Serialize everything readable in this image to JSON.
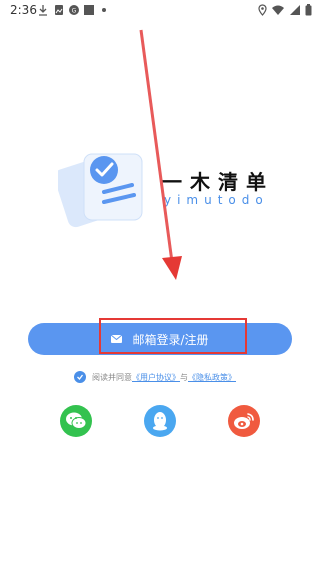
{
  "status_bar": {
    "time": "2:36",
    "left_icons": [
      "download-icon",
      "image-icon",
      "circle-icon",
      "square-icon",
      "dot-icon"
    ],
    "right_icons": [
      "location-icon",
      "wifi-icon",
      "signal-icon",
      "battery-icon"
    ]
  },
  "brand": {
    "title": "一木清单",
    "subtitle": "yimutodo",
    "accent_color": "#4a8fe8"
  },
  "login": {
    "email_button_label": "邮箱登录/注册",
    "button_color": "#5a96f0"
  },
  "agreement": {
    "prefix": "阅读并同意",
    "user_agreement": "《用户协议》",
    "joiner": "与",
    "privacy_policy": "《隐私政策》",
    "checked": true
  },
  "social_login": [
    {
      "name": "wechat-icon",
      "color": "#33c24f"
    },
    {
      "name": "qq-icon",
      "color": "#4aa7f0"
    },
    {
      "name": "weibo-icon",
      "color": "#f05a3f"
    }
  ],
  "annotation": {
    "arrow_color": "#e53935",
    "highlight_color": "#e53935"
  }
}
